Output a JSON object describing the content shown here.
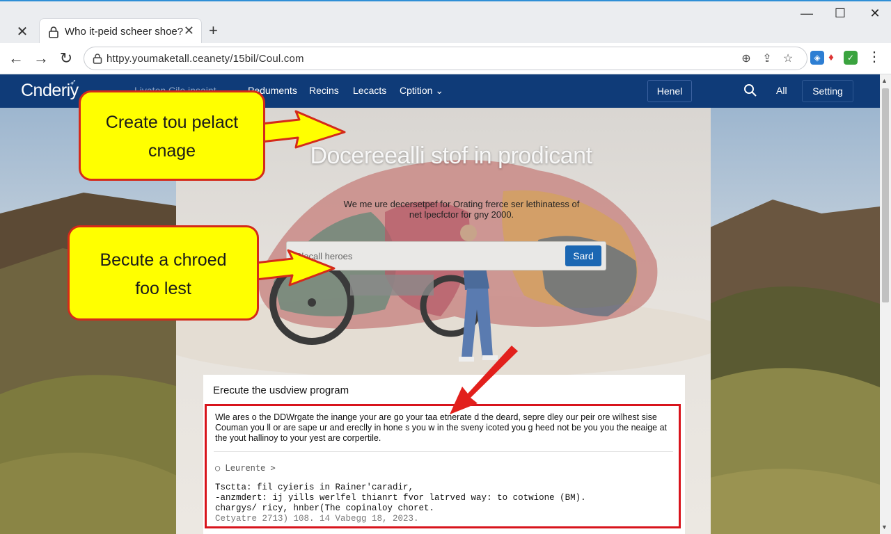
{
  "browser": {
    "tab_title": "Who it-peid scheer shoe?",
    "url": "httpy.youmaketall.ceanety/15bil/Coul.com"
  },
  "site": {
    "logo": "Cnderiy",
    "nav_faded": "Livaton Cile insaint",
    "nav": [
      "Peduments",
      "Recins",
      "Lecacts",
      "Cptition"
    ],
    "nav_button": "Henel",
    "nav_all": "All",
    "nav_setting": "Setting"
  },
  "hero": {
    "title": "Docereealli stof in prodicant",
    "subtitle_line1": "We me ure decersetpef for Orating frerce ser lethinatess of",
    "subtitle_line2": "net lpecfctor for gny 2000.",
    "search_placeholder": "Clecall heroes",
    "search_button": "Sard"
  },
  "card": {
    "title": "Erecute the usdview program",
    "body": "Wle ares o the DDWrgate the inange your are go your taa etnerate d the deard, sepre dley our peir ore wilhest sise Couman you ll or are sape ur and ereclly in hone s you w in the sveny icoted you g heed not be you you the neaige at the yout hallinoy to your yest are corpertile.",
    "link": "Leurente >",
    "code_line1": "Tsctta: fil cyieris in Rainer'caradir,",
    "code_line2": "-anzmdert: ij yills werlfel thianrt fvor latrved way: to cotwione (BM).",
    "code_line3": "chargys/ ricy, hnber(The copinaloy choret.",
    "code_line4": "Cetyatre 2713) 108. 14 Vabegg 18, 2023."
  },
  "annotations": {
    "callout_top_line1": "Create tou pelact",
    "callout_top_line2": "cnage",
    "callout_mid_line1": "Becute a chroed",
    "callout_mid_line2": "foo lest"
  },
  "colors": {
    "nav_bg": "#0f3b78",
    "accent_button": "#1b67b3",
    "callout_fill": "#ffff00",
    "annotation_red": "#d8141c"
  }
}
